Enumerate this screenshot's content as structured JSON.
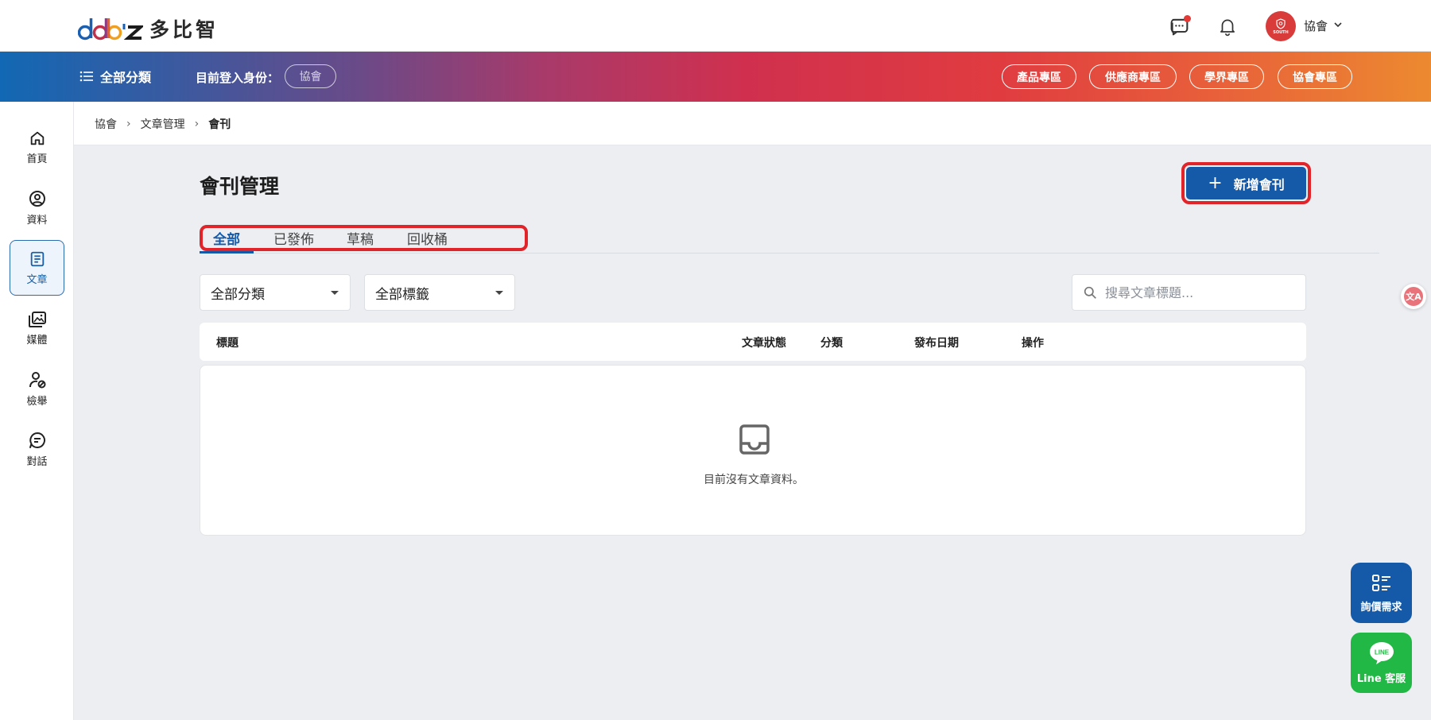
{
  "brand": {
    "name": "多比智"
  },
  "header": {
    "user_name": "協會",
    "avatar_text": "SOUTH"
  },
  "navbar": {
    "all_categories": "全部分類",
    "identity_label": "目前登入身份：",
    "identity_role": "協會",
    "zones": [
      "產品專區",
      "供應商專區",
      "學界專區",
      "協會專區"
    ]
  },
  "sidebar": {
    "items": [
      {
        "label": "首頁",
        "icon": "home-icon"
      },
      {
        "label": "資料",
        "icon": "user-circle-icon"
      },
      {
        "label": "文章",
        "icon": "article-icon",
        "active": true
      },
      {
        "label": "媒體",
        "icon": "media-icon"
      },
      {
        "label": "檢舉",
        "icon": "report-user-icon"
      },
      {
        "label": "對話",
        "icon": "chat-icon"
      }
    ]
  },
  "breadcrumb": [
    "協會",
    "文章管理",
    "會刊"
  ],
  "main": {
    "title": "會刊管理",
    "add_button": "新增會刊",
    "tabs": [
      "全部",
      "已發佈",
      "草稿",
      "回收桶"
    ],
    "active_tab": "全部",
    "filters": {
      "category": "全部分類",
      "tags": "全部標籤"
    },
    "search_placeholder": "搜尋文章標題...",
    "columns": [
      "標題",
      "文章狀態",
      "分類",
      "發布日期",
      "操作"
    ],
    "empty_text": "目前沒有文章資料。"
  },
  "fabs": {
    "inquiry": "詢價需求",
    "line": "Line 客服",
    "line_badge": "LINE"
  },
  "colors": {
    "primary": "#145aa8",
    "highlight": "#e0242a",
    "line_green": "#22b845"
  }
}
